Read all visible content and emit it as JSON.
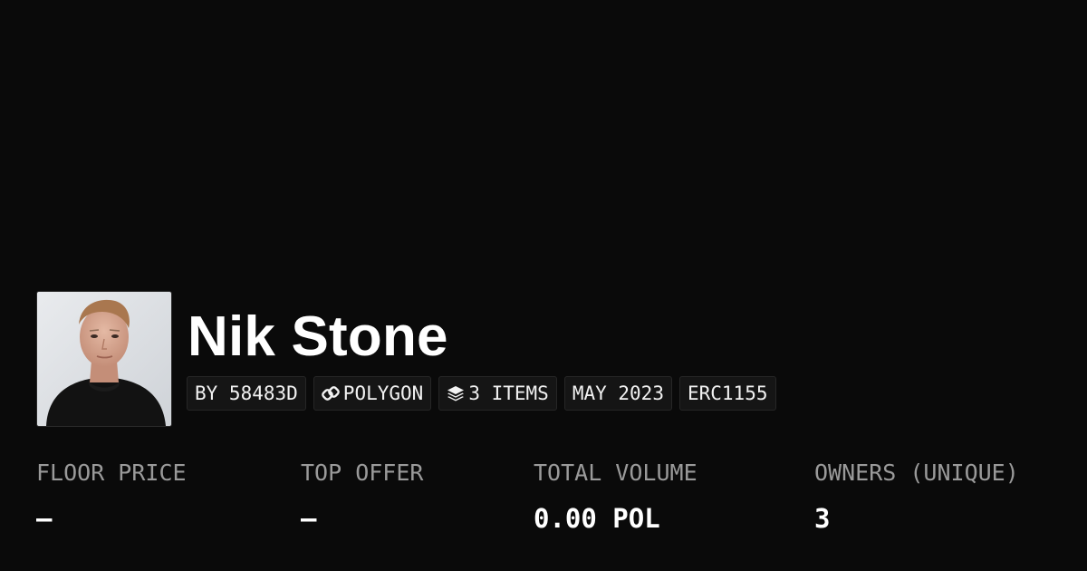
{
  "collection": {
    "name": "Nik Stone",
    "tags": [
      {
        "label": "BY 58483D",
        "icon": null
      },
      {
        "label": "POLYGON",
        "icon": "chain-link-icon"
      },
      {
        "label": "3 ITEMS",
        "icon": "layers-icon"
      },
      {
        "label": "MAY 2023",
        "icon": null
      },
      {
        "label": "ERC1155",
        "icon": null
      }
    ]
  },
  "stats": [
    {
      "label": "FLOOR PRICE",
      "value": "—"
    },
    {
      "label": "TOP OFFER",
      "value": "—"
    },
    {
      "label": "TOTAL VOLUME",
      "value": "0.00 POL"
    },
    {
      "label": "OWNERS (UNIQUE)",
      "value": "3"
    }
  ],
  "colors": {
    "background": "#0a0a0a",
    "text": "#ffffff",
    "muted": "#9a9a9a",
    "tag_background": "#151515",
    "tag_border": "#262626"
  }
}
